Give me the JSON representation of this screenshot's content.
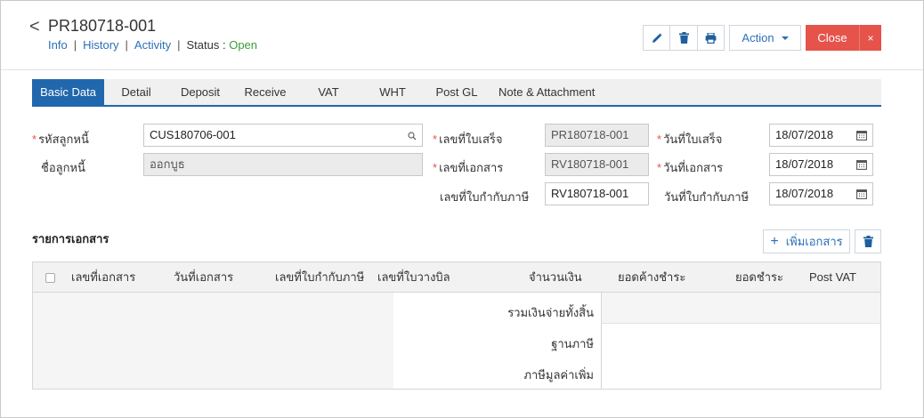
{
  "header": {
    "back_glyph": "<",
    "doc_number": "PR180718-001",
    "links": {
      "info": "Info",
      "history": "History",
      "activity": "Activity"
    },
    "separator": "|",
    "status_label": "Status",
    "status_colon": ":",
    "status_value": "Open",
    "status_color": "#3a9d3a"
  },
  "toolbar": {
    "edit_icon": "pencil-icon",
    "delete_icon": "trash-icon",
    "print_icon": "printer-icon",
    "action_label": "Action",
    "close_label": "Close",
    "close_x": "×",
    "close_color": "#e5534b"
  },
  "tabs": [
    {
      "label": "Basic Data",
      "active": true
    },
    {
      "label": "Detail"
    },
    {
      "label": "Deposit"
    },
    {
      "label": "Receive"
    },
    {
      "label": "VAT"
    },
    {
      "label": "WHT"
    },
    {
      "label": "Post GL"
    },
    {
      "label": "Note & Attachment"
    }
  ],
  "form": {
    "required_mark": "*",
    "debtor_code_label": "รหัสลูกหนี้",
    "debtor_code_value": "CUS180706-001",
    "debtor_name_label": "ชื่อลูกหนี้",
    "debtor_name_value": "ออกบูธ",
    "receipt_no_label": "เลขที่ใบเสร็จ",
    "receipt_no_value": "PR180718-001",
    "doc_no_label": "เลขที่เอกสาร",
    "doc_no_value": "RV180718-001",
    "tax_invoice_no_label": "เลขที่ใบกำกับภาษี",
    "tax_invoice_no_value": "RV180718-001",
    "receipt_date_label": "วันที่ใบเสร็จ",
    "receipt_date_value": "18/07/2018",
    "doc_date_label": "วันที่เอกสาร",
    "doc_date_value": "18/07/2018",
    "tax_invoice_date_label": "วันที่ใบกำกับภาษี",
    "tax_invoice_date_value": "18/07/2018"
  },
  "documents": {
    "title": "รายการเอกสาร",
    "add_label": "เพิ่มเอกสาร",
    "add_glyph": "+",
    "columns": [
      "เลขที่เอกสาร",
      "วันที่เอกสาร",
      "เลขที่ใบกำกับภาษี",
      "เลขที่ใบวางบิล",
      "จำนวนเงิน",
      "ยอดค้างชำระ",
      "ยอดชำระ",
      "Post VAT"
    ],
    "summary": {
      "total_label": "รวมเงินจ่ายทั้งสิ้น",
      "tax_base_label": "ฐานภาษี",
      "vat_label": "ภาษีมูลค่าเพิ่ม"
    }
  },
  "colors": {
    "accent": "#2167ae",
    "link": "#2c6fb7",
    "required": "#e5534b"
  }
}
